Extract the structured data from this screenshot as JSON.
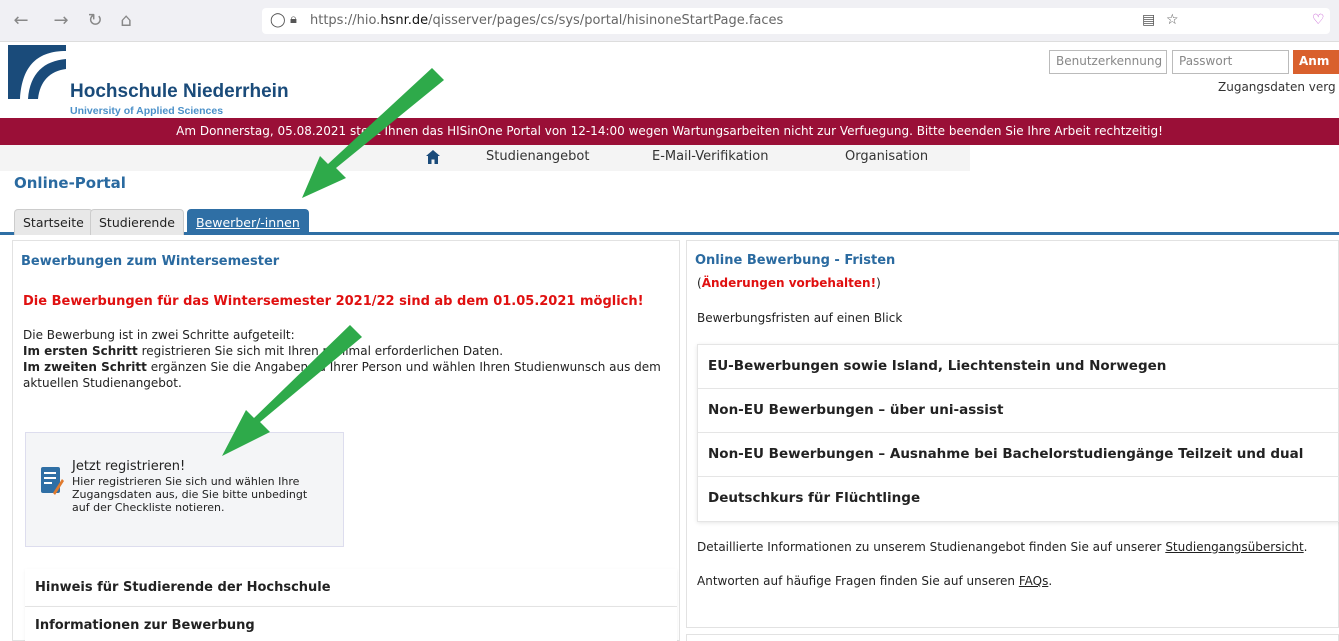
{
  "browser": {
    "url_prefix": "https://hio.",
    "url_domain": "hsnr.de",
    "url_path": "/qisserver/pages/cs/sys/portal/hisinoneStartPage.faces"
  },
  "header": {
    "logo_name": "Hochschule Niederrhein",
    "logo_sub": "University of Applied Sciences",
    "username_placeholder": "Benutzerkennung",
    "password_placeholder": "Passwort",
    "login_label": "Anm",
    "forgot_link": "Zugangsdaten verg"
  },
  "banner": {
    "text": "Am Donnerstag, 05.08.2021 steht Ihnen das HISinOne Portal von 12-14:00 wegen Wartungsarbeiten nicht zur Verfuegung. Bitte beenden Sie Ihre Arbeit rechtzeitig!"
  },
  "nav": {
    "items": [
      "Studienangebot",
      "E-Mail-Verifikation",
      "Organisation"
    ]
  },
  "portal_title": "Online-Portal",
  "tabs": [
    "Startseite",
    "Studierende",
    "Bewerber/-innen"
  ],
  "left": {
    "title": "Bewerbungen zum Wintersemester",
    "red_note": "Die Bewerbungen für das Wintersemester 2021/22 sind ab dem 01.05.2021 möglich!",
    "desc_line1": "Die Bewerbung ist in zwei Schritte aufgeteilt:",
    "step1_bold": "Im ersten Schritt",
    "step1_text": " registrieren Sie sich mit Ihren minimal erforderlichen Daten.",
    "step2_bold": "Im zweiten Schritt",
    "step2_text": " ergänzen Sie die Angaben zu Ihrer Person und wählen Ihren Studienwunsch aus dem aktuellen Studienangebot.",
    "register_title": "Jetzt registrieren!",
    "register_text": "Hier registrieren Sie sich und wählen Ihre Zugangsdaten aus, die Sie bitte unbedingt auf der Checkliste notieren.",
    "accordion": [
      "Hinweis für Studierende der Hochschule",
      "Informationen zur Bewerbung"
    ]
  },
  "right": {
    "title": "Online Bewerbung - Fristen",
    "subnote_open": "(",
    "subnote_red": "Änderungen vorbehalten!",
    "subnote_close": ")",
    "lead": "Bewerbungsfristen auf einen Blick",
    "accordion": [
      "EU-Bewerbungen sowie Island, Liechtenstein und Norwegen",
      "Non-EU Bewerbungen – über uni-assist",
      "Non-EU Bewerbungen – Ausnahme bei Bachelorstudiengänge Teilzeit und dual",
      "Deutschkurs für Flüchtlinge"
    ],
    "info1_text": "Detaillierte Informationen zu unserem Studienangebot finden Sie auf unserer ",
    "info1_link": "Studiengangsübersicht",
    "info1_end": ".",
    "info2_text": "Antworten auf häufige Fragen finden Sie auf unseren ",
    "info2_link": "FAQs",
    "info2_end": "."
  },
  "colors": {
    "brand_blue": "#1a4b7a",
    "banner": "#9a0f37",
    "tab_active": "#2f6fa5",
    "alert_red": "#e01010",
    "login_orange": "#d9602d",
    "arrow_green": "#2eaa4a"
  }
}
